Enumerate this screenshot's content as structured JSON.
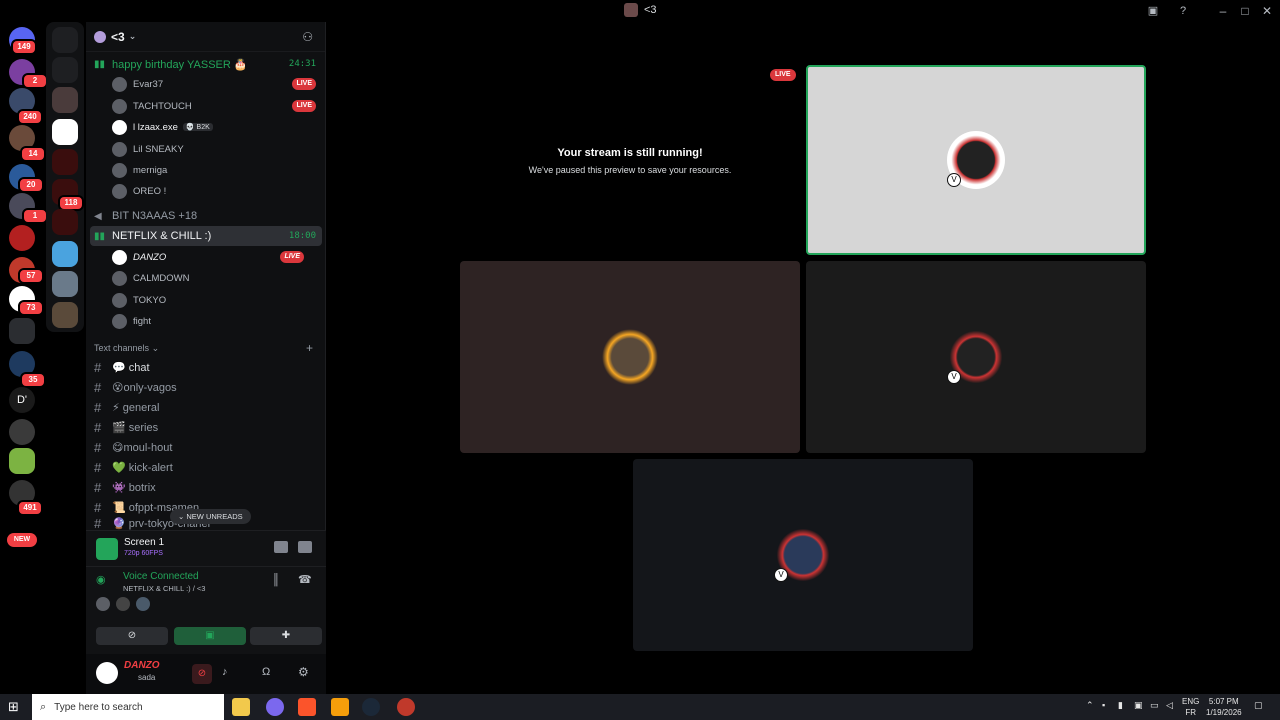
{
  "window": {
    "title": "<3"
  },
  "rail": {
    "badges": [
      "149",
      "2",
      "240",
      "14",
      "20",
      "1",
      "57",
      "73",
      "35",
      "118",
      "491"
    ],
    "new_label": "NEW",
    "dm_letter": "D'"
  },
  "sidebar": {
    "server_name": "<3",
    "voice_channels": [
      {
        "name": "happy birthday YASSER 🎂",
        "timer": "24:31"
      },
      {
        "name": "BIT N3AAAS +18"
      },
      {
        "name": "NETFLIX & CHILL :)",
        "timer": "18:00"
      }
    ],
    "members_birthday": [
      {
        "name": "Evar37",
        "live": "LIVE"
      },
      {
        "name": "TACHTOUCH",
        "live": "LIVE"
      },
      {
        "name": "l lzaax.exe",
        "tag": "💀 B2K"
      },
      {
        "name": "Lil SNEAKY"
      },
      {
        "name": "merniga"
      },
      {
        "name": "OREO !"
      }
    ],
    "members_netflix": [
      {
        "name": "DANZO",
        "live": "LIVE"
      },
      {
        "name": "CALMDOWN"
      },
      {
        "name": "TOKYO"
      },
      {
        "name": "fight"
      }
    ],
    "text_category": "Text channels",
    "text_channels": [
      {
        "name": "💬 chat"
      },
      {
        "name": "😵only-vagos"
      },
      {
        "name": "⚡ general"
      },
      {
        "name": "🎬 series"
      },
      {
        "name": "😋moul-hout"
      },
      {
        "name": "💚 kick-alert"
      },
      {
        "name": "👾 botrix"
      },
      {
        "name": "📜 ofppt-msamen"
      },
      {
        "name": "🔮 prv-tokyo-chanel"
      }
    ],
    "new_unreads": "NEW UNREADS"
  },
  "screen_panel": {
    "title": "Screen 1",
    "quality": "720p 60FPS"
  },
  "voice_panel": {
    "status": "Voice Connected",
    "channel": "NETFLIX & CHILL :) / <3"
  },
  "user_panel": {
    "username": "DANZO",
    "status": "sada"
  },
  "stage": {
    "live_label": "LIVE",
    "paused_title": "Your stream is still running!",
    "paused_subtitle": "We've paused this preview to save your resources."
  },
  "taskbar": {
    "search_placeholder": "Type here to search",
    "lang_top": "ENG",
    "lang_bottom": "FR",
    "time": "5:07 PM",
    "date": "1/19/2026"
  },
  "colors": {
    "accent_green": "#23a55a",
    "live_red": "#da373c",
    "blurple": "#5865f2"
  }
}
